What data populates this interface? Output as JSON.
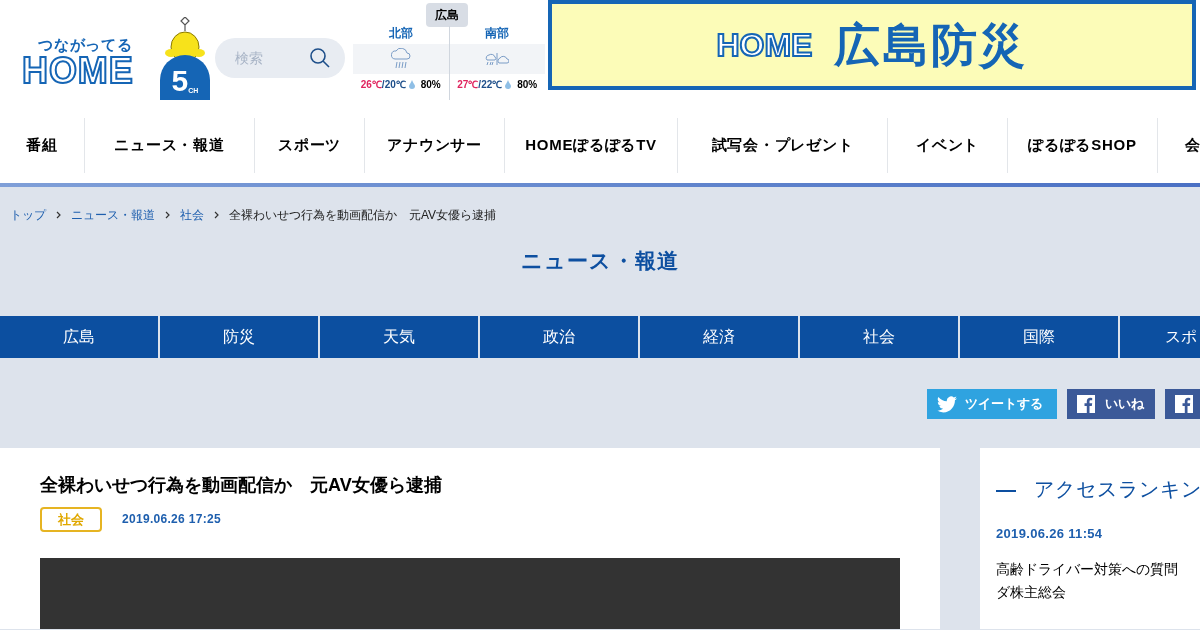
{
  "logo": {
    "tagline": "つながってる",
    "name": "HOME",
    "channel": "5",
    "channel_suffix": "CH"
  },
  "search": {
    "placeholder": "検索"
  },
  "weather": {
    "region_tabs": [
      {
        "label": "広島",
        "selected": true
      }
    ],
    "areas": [
      {
        "name": "北部",
        "kind": "rain",
        "high": "26℃",
        "separator": "/",
        "low": "20℃",
        "rain_chance": "80%"
      },
      {
        "name": "南部",
        "kind": "rain_cloud",
        "high": "27℃",
        "separator": "/",
        "low": "22℃",
        "rain_chance": "80%"
      }
    ]
  },
  "banner": {
    "brand": "HOME",
    "title": "広島防災"
  },
  "nav": [
    "番組",
    "ニュース・報道",
    "スポーツ",
    "アナウンサー",
    "HOMEぽるぽるTV",
    "試写会・プレゼント",
    "イベント",
    "ぽるぽるSHOP",
    "会"
  ],
  "breadcrumb": [
    {
      "label": "トップ",
      "link": true
    },
    {
      "label": "ニュース・報道",
      "link": true
    },
    {
      "label": "社会",
      "link": true
    },
    {
      "label": "全裸わいせつ行為を動画配信か　元AV女優ら逮捕",
      "link": false
    }
  ],
  "section_title": "ニュース・報道",
  "category_tabs": [
    "広島",
    "防災",
    "天気",
    "政治",
    "経済",
    "社会",
    "国際",
    "スポ"
  ],
  "share_buttons": [
    {
      "kind": "twitter",
      "label": "ツイートする"
    },
    {
      "kind": "facebook",
      "label": "いいね"
    },
    {
      "kind": "facebook"
    }
  ],
  "article": {
    "title": "全裸わいせつ行為を動画配信か　元AV女優ら逮捕",
    "category": "社会",
    "date": "2019.06.26 17:25"
  },
  "ranking": {
    "dash": "—",
    "title": "アクセスランキン",
    "items": [
      {
        "date": "2019.06.26 11:54",
        "lines": [
          "高齢ドライバー対策への質問",
          "ダ株主総会"
        ]
      }
    ]
  }
}
